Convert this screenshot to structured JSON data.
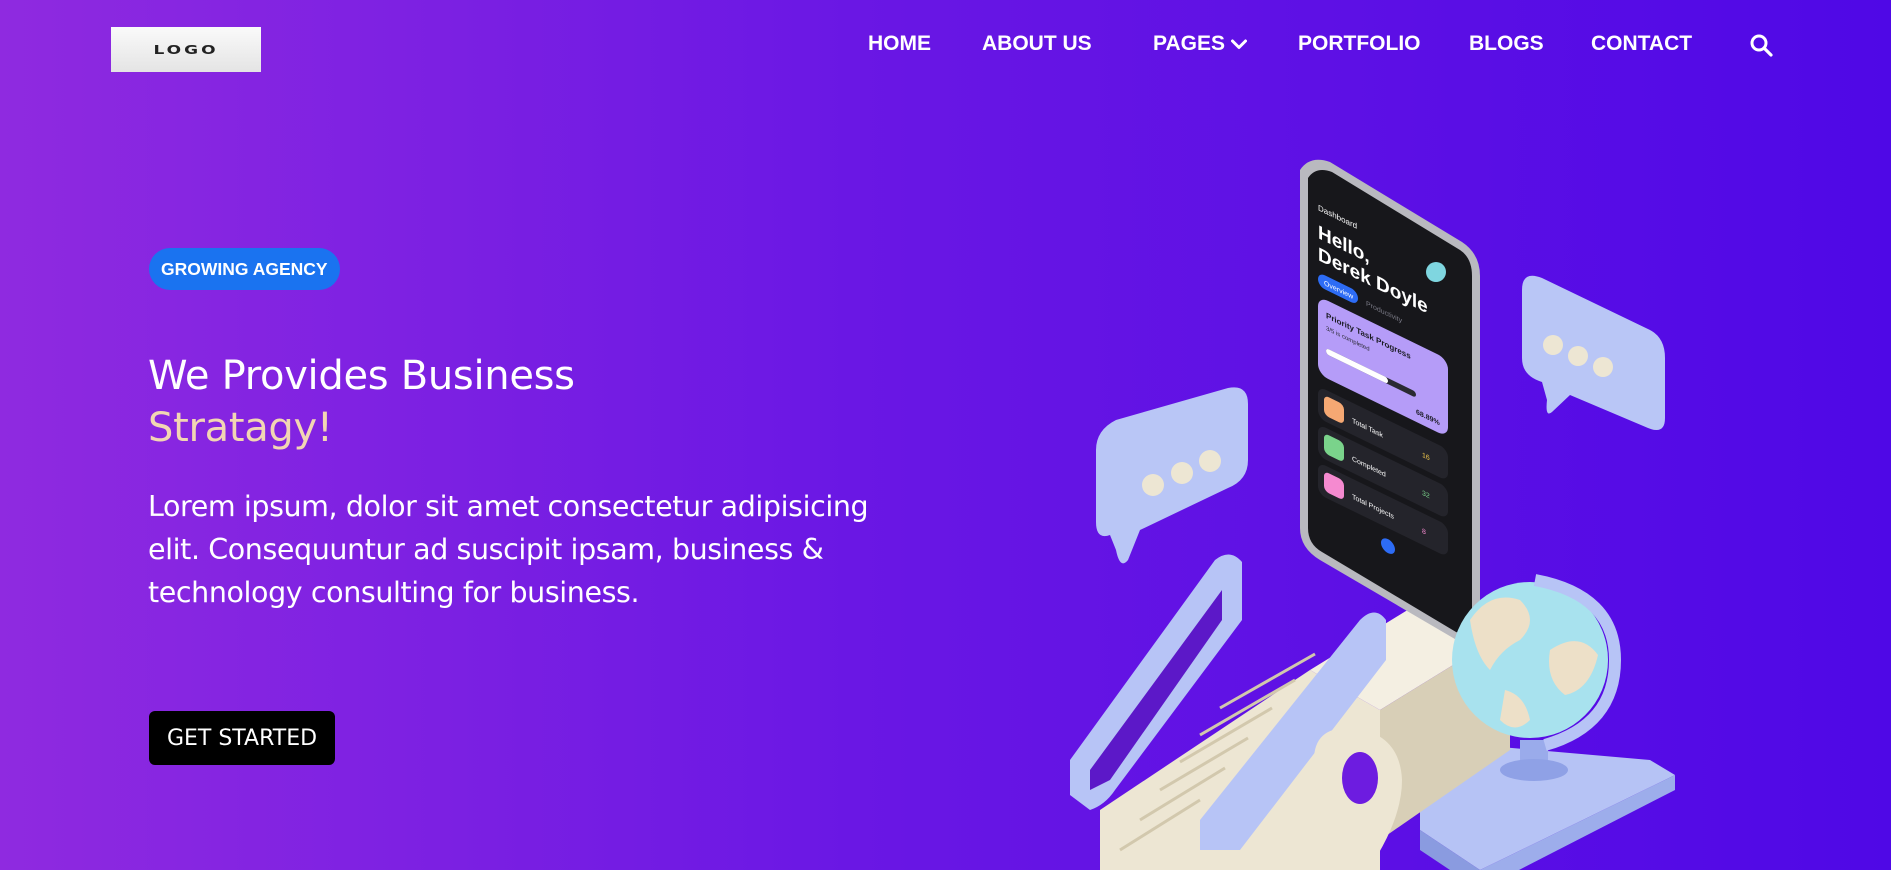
{
  "header": {
    "logo_text": "LOGO",
    "nav": [
      {
        "label": "HOME"
      },
      {
        "label": "ABOUT US"
      },
      {
        "label": "PAGES"
      },
      {
        "label": "PORTFOLIO"
      },
      {
        "label": "BLOGS"
      },
      {
        "label": "CONTACT"
      }
    ],
    "search_icon": "search-icon"
  },
  "hero": {
    "badge": "GROWING AGENCY",
    "title_line1": "We Provides Business",
    "title_line2": "Stratagy!",
    "description": "Lorem ipsum, dolor sit amet consectetur adipisicing elit. Consequuntur ad suscipit ipsam, business & technology consulting for business.",
    "cta_label": "GET STARTED"
  },
  "phone": {
    "screen_title": "Dashboard",
    "greeting_line1": "Hello,",
    "greeting_line2": "Derek Doyle",
    "tab_active": "Overview",
    "tab_inactive": "Productivity",
    "card_title": "Priority Task Progress",
    "card_sub": "3/5 is completed",
    "card_percent": "68.89%",
    "card_progress": 0.69,
    "rows": [
      {
        "label": "Total Task",
        "value": "16"
      },
      {
        "label": "Completed",
        "value": "32"
      },
      {
        "label": "Total Projects",
        "value": "8"
      }
    ]
  },
  "colors": {
    "badge": "#1a73f0",
    "accent_title": "#f2d6b3",
    "cta_bg": "#000000"
  }
}
